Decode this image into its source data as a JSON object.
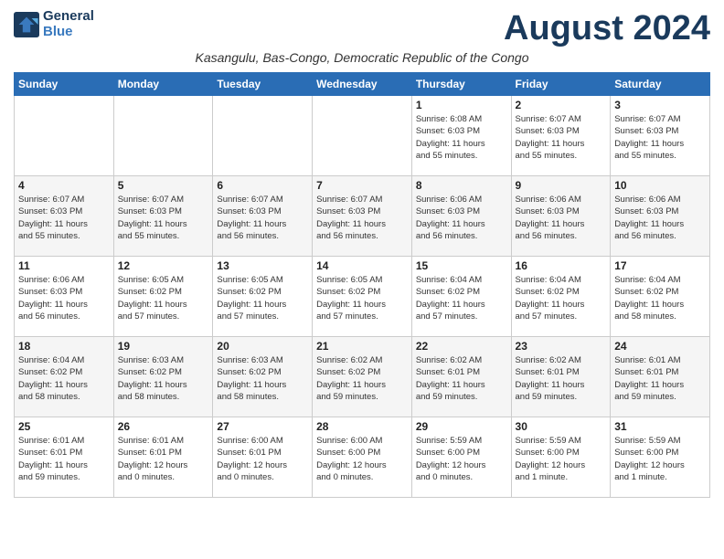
{
  "header": {
    "logo_line1": "General",
    "logo_line2": "Blue",
    "month_year": "August 2024",
    "subtitle": "Kasangulu, Bas-Congo, Democratic Republic of the Congo"
  },
  "weekdays": [
    "Sunday",
    "Monday",
    "Tuesday",
    "Wednesday",
    "Thursday",
    "Friday",
    "Saturday"
  ],
  "weeks": [
    [
      {
        "day": "",
        "info": ""
      },
      {
        "day": "",
        "info": ""
      },
      {
        "day": "",
        "info": ""
      },
      {
        "day": "",
        "info": ""
      },
      {
        "day": "1",
        "info": "Sunrise: 6:08 AM\nSunset: 6:03 PM\nDaylight: 11 hours\nand 55 minutes."
      },
      {
        "day": "2",
        "info": "Sunrise: 6:07 AM\nSunset: 6:03 PM\nDaylight: 11 hours\nand 55 minutes."
      },
      {
        "day": "3",
        "info": "Sunrise: 6:07 AM\nSunset: 6:03 PM\nDaylight: 11 hours\nand 55 minutes."
      }
    ],
    [
      {
        "day": "4",
        "info": "Sunrise: 6:07 AM\nSunset: 6:03 PM\nDaylight: 11 hours\nand 55 minutes."
      },
      {
        "day": "5",
        "info": "Sunrise: 6:07 AM\nSunset: 6:03 PM\nDaylight: 11 hours\nand 55 minutes."
      },
      {
        "day": "6",
        "info": "Sunrise: 6:07 AM\nSunset: 6:03 PM\nDaylight: 11 hours\nand 56 minutes."
      },
      {
        "day": "7",
        "info": "Sunrise: 6:07 AM\nSunset: 6:03 PM\nDaylight: 11 hours\nand 56 minutes."
      },
      {
        "day": "8",
        "info": "Sunrise: 6:06 AM\nSunset: 6:03 PM\nDaylight: 11 hours\nand 56 minutes."
      },
      {
        "day": "9",
        "info": "Sunrise: 6:06 AM\nSunset: 6:03 PM\nDaylight: 11 hours\nand 56 minutes."
      },
      {
        "day": "10",
        "info": "Sunrise: 6:06 AM\nSunset: 6:03 PM\nDaylight: 11 hours\nand 56 minutes."
      }
    ],
    [
      {
        "day": "11",
        "info": "Sunrise: 6:06 AM\nSunset: 6:03 PM\nDaylight: 11 hours\nand 56 minutes."
      },
      {
        "day": "12",
        "info": "Sunrise: 6:05 AM\nSunset: 6:02 PM\nDaylight: 11 hours\nand 57 minutes."
      },
      {
        "day": "13",
        "info": "Sunrise: 6:05 AM\nSunset: 6:02 PM\nDaylight: 11 hours\nand 57 minutes."
      },
      {
        "day": "14",
        "info": "Sunrise: 6:05 AM\nSunset: 6:02 PM\nDaylight: 11 hours\nand 57 minutes."
      },
      {
        "day": "15",
        "info": "Sunrise: 6:04 AM\nSunset: 6:02 PM\nDaylight: 11 hours\nand 57 minutes."
      },
      {
        "day": "16",
        "info": "Sunrise: 6:04 AM\nSunset: 6:02 PM\nDaylight: 11 hours\nand 57 minutes."
      },
      {
        "day": "17",
        "info": "Sunrise: 6:04 AM\nSunset: 6:02 PM\nDaylight: 11 hours\nand 58 minutes."
      }
    ],
    [
      {
        "day": "18",
        "info": "Sunrise: 6:04 AM\nSunset: 6:02 PM\nDaylight: 11 hours\nand 58 minutes."
      },
      {
        "day": "19",
        "info": "Sunrise: 6:03 AM\nSunset: 6:02 PM\nDaylight: 11 hours\nand 58 minutes."
      },
      {
        "day": "20",
        "info": "Sunrise: 6:03 AM\nSunset: 6:02 PM\nDaylight: 11 hours\nand 58 minutes."
      },
      {
        "day": "21",
        "info": "Sunrise: 6:02 AM\nSunset: 6:02 PM\nDaylight: 11 hours\nand 59 minutes."
      },
      {
        "day": "22",
        "info": "Sunrise: 6:02 AM\nSunset: 6:01 PM\nDaylight: 11 hours\nand 59 minutes."
      },
      {
        "day": "23",
        "info": "Sunrise: 6:02 AM\nSunset: 6:01 PM\nDaylight: 11 hours\nand 59 minutes."
      },
      {
        "day": "24",
        "info": "Sunrise: 6:01 AM\nSunset: 6:01 PM\nDaylight: 11 hours\nand 59 minutes."
      }
    ],
    [
      {
        "day": "25",
        "info": "Sunrise: 6:01 AM\nSunset: 6:01 PM\nDaylight: 11 hours\nand 59 minutes."
      },
      {
        "day": "26",
        "info": "Sunrise: 6:01 AM\nSunset: 6:01 PM\nDaylight: 12 hours\nand 0 minutes."
      },
      {
        "day": "27",
        "info": "Sunrise: 6:00 AM\nSunset: 6:01 PM\nDaylight: 12 hours\nand 0 minutes."
      },
      {
        "day": "28",
        "info": "Sunrise: 6:00 AM\nSunset: 6:00 PM\nDaylight: 12 hours\nand 0 minutes."
      },
      {
        "day": "29",
        "info": "Sunrise: 5:59 AM\nSunset: 6:00 PM\nDaylight: 12 hours\nand 0 minutes."
      },
      {
        "day": "30",
        "info": "Sunrise: 5:59 AM\nSunset: 6:00 PM\nDaylight: 12 hours\nand 1 minute."
      },
      {
        "day": "31",
        "info": "Sunrise: 5:59 AM\nSunset: 6:00 PM\nDaylight: 12 hours\nand 1 minute."
      }
    ]
  ]
}
